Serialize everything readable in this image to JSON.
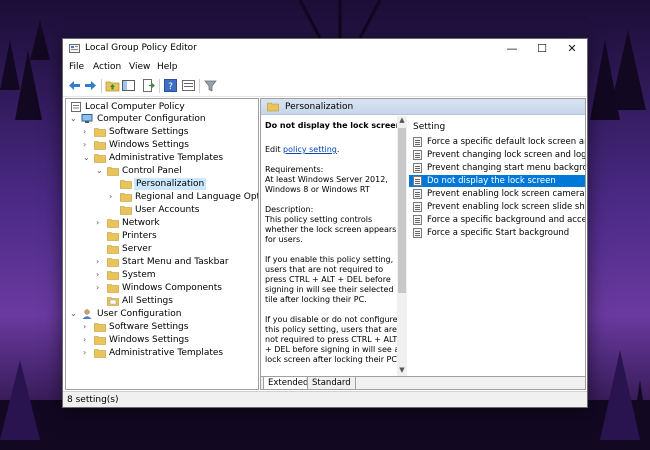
{
  "window": {
    "title": "Local Group Policy Editor",
    "minimize": "—",
    "maximize": "☐",
    "close": "✕"
  },
  "menu": [
    "File",
    "Action",
    "View",
    "Help"
  ],
  "toolbar": {
    "icons": [
      "back-arrow-icon",
      "forward-arrow-icon",
      "up-folder-icon",
      "show-hide-tree-icon",
      "export-list-icon",
      "help-icon",
      "properties-icon",
      "filter-icon"
    ]
  },
  "tree": {
    "root": "Local Computer Policy",
    "computer_configuration": "Computer Configuration",
    "software_settings": "Software Settings",
    "windows_settings": "Windows Settings",
    "administrative_templates": "Administrative Templates",
    "control_panel": "Control Panel",
    "personalization": "Personalization",
    "regional": "Regional and Language Options",
    "user_accounts": "User Accounts",
    "network": "Network",
    "printers": "Printers",
    "server": "Server",
    "start_menu": "Start Menu and Taskbar",
    "system": "System",
    "windows_components": "Windows Components",
    "all_settings": "All Settings",
    "user_configuration": "User Configuration",
    "u_software_settings": "Software Settings",
    "u_windows_settings": "Windows Settings",
    "u_administrative_templates": "Administrative Templates"
  },
  "panel": {
    "header": "Personalization",
    "desc_title": "Do not display the lock screen",
    "edit_prefix": "Edit ",
    "edit_link": "policy setting",
    "edit_suffix": ".",
    "requirements_label": "Requirements:",
    "requirements_text": "At least Windows Server 2012, Windows 8 or Windows RT",
    "description_label": "Description:",
    "description_text": "This policy setting controls whether the lock screen appears for users.",
    "para_enable": "If you enable this policy setting, users that are not required to press CTRL + ALT + DEL before signing in will see their selected tile after locking their PC.",
    "para_disable": "If you disable or do not configure this policy setting, users that are not required to press CTRL + ALT + DEL before signing in will see a lock screen after locking their PC.",
    "setting_header": "Setting",
    "settings": [
      "Force a specific default lock screen and logo",
      "Prevent changing lock screen and logon image",
      "Prevent changing start menu background",
      "Do not display the lock screen",
      "Prevent enabling lock screen camera",
      "Prevent enabling lock screen slide show",
      "Force a specific background and accent color",
      "Force a specific Start background"
    ],
    "selected_index": 3
  },
  "tabs": {
    "extended": "Extended",
    "standard": "Standard"
  },
  "status": "8 setting(s)",
  "colors": {
    "selection": "#0078d7",
    "tree_selection": "#cce8ff",
    "folder": "#e8c45a",
    "link": "#0645ad"
  }
}
